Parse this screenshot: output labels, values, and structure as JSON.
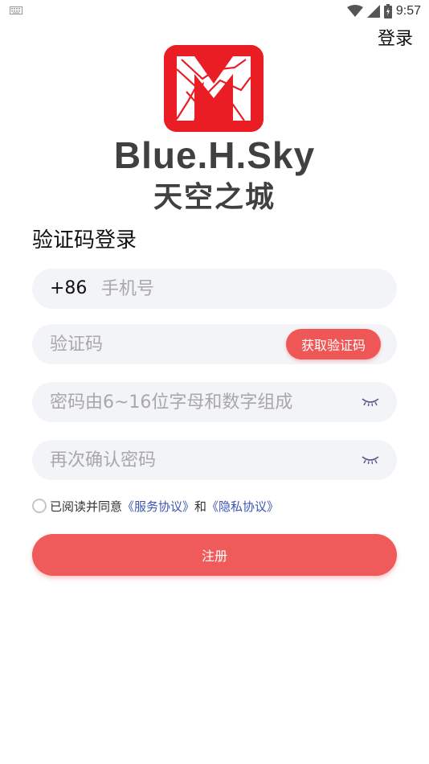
{
  "status_bar": {
    "time": "9:57"
  },
  "header": {
    "login_link": "登录"
  },
  "brand": {
    "name": "Blue.H.Sky",
    "subtitle": "天空之城",
    "logo_color": "#ea1c24"
  },
  "page": {
    "title": "验证码登录"
  },
  "form": {
    "phone": {
      "country_code": "+86",
      "placeholder": "手机号"
    },
    "code": {
      "placeholder": "验证码",
      "button_label": "获取验证码"
    },
    "password": {
      "placeholder": "密码由6~16位字母和数字组成"
    },
    "confirm": {
      "placeholder": "再次确认密码"
    },
    "agreement": {
      "prefix": "已阅读并同意",
      "service_link": "《服务协议》",
      "and": "和",
      "privacy_link": "《隐私协议》"
    },
    "submit_label": "注册"
  },
  "colors": {
    "accent": "#ef5757",
    "field_bg": "#f3f4f7",
    "link": "#3b55b4"
  }
}
